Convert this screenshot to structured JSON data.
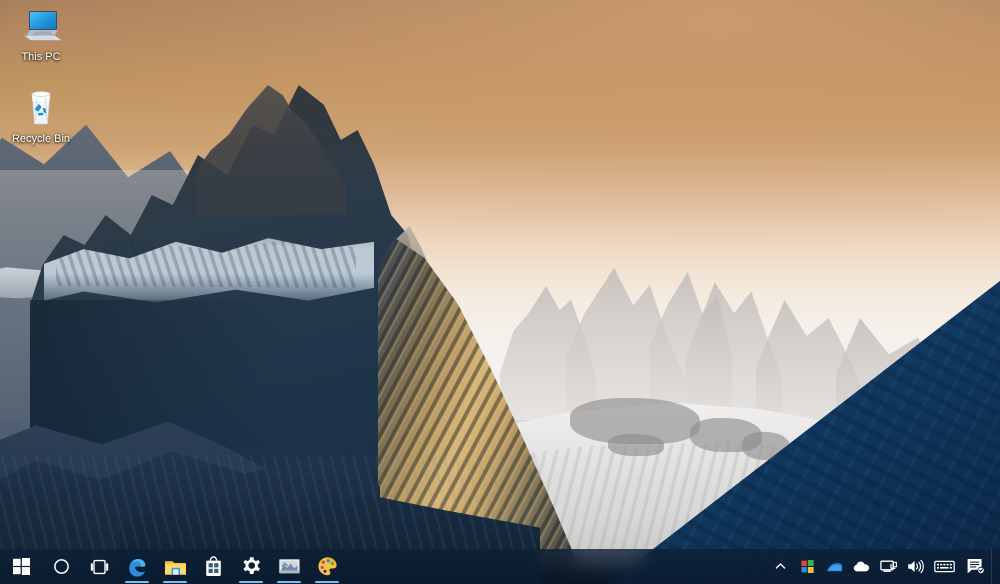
{
  "desktop": {
    "wallpaper_name": "torres-del-paine-mountains",
    "wallpaper_description": "Sunrise over jagged snow-dusted mountain peaks with warm tan sky and deep blue rock faces",
    "colors": {
      "sky_top": "#a9805d",
      "sky_mid": "#cda273",
      "sky_horizon": "#f2efec",
      "rock_dark_blue": "#1e3549",
      "rock_right_slope": "#113a62",
      "sunlit_ridge_gold": "#d9b877",
      "snow": "#e7e6e5",
      "taskbar_bg": "#0d2036",
      "taskbar_indicator": "#6fc3f0",
      "icon_label_text": "#ffffff"
    },
    "icons": [
      {
        "id": "this-pc",
        "label": "This PC",
        "icon": "monitor-computer-icon"
      },
      {
        "id": "recycle-bin",
        "label": "Recycle Bin",
        "icon": "recycle-bin-icon"
      }
    ]
  },
  "taskbar": {
    "start": {
      "label": "Start",
      "icon": "windows-logo-icon"
    },
    "search": {
      "label": "Cortana",
      "icon": "cortana-circle-icon"
    },
    "task_view": {
      "label": "Task View",
      "icon": "task-view-icon"
    },
    "pinned": [
      {
        "id": "edge",
        "label": "Microsoft Edge",
        "icon": "edge-icon",
        "running": true
      },
      {
        "id": "file-explorer",
        "label": "File Explorer",
        "icon": "folder-icon",
        "running": true
      },
      {
        "id": "store",
        "label": "Microsoft Store",
        "icon": "store-bag-icon",
        "running": false
      },
      {
        "id": "settings",
        "label": "Settings",
        "icon": "gear-icon",
        "running": true
      },
      {
        "id": "photos",
        "label": "Photos",
        "icon": "photo-picture-icon",
        "running": true
      },
      {
        "id": "paint",
        "label": "Paint",
        "icon": "paint-palette-icon",
        "running": true
      }
    ],
    "tray": [
      {
        "id": "show-hidden",
        "label": "Show hidden icons",
        "icon": "chevron-up-icon"
      },
      {
        "id": "security",
        "label": "Windows Security",
        "icon": "security-shield-icon"
      },
      {
        "id": "graphics",
        "label": "Graphics settings",
        "icon": "graphics-icon"
      },
      {
        "id": "onedrive",
        "label": "OneDrive",
        "icon": "cloud-icon"
      },
      {
        "id": "network",
        "label": "Network",
        "icon": "network-monitor-icon"
      },
      {
        "id": "volume",
        "label": "Speakers",
        "icon": "speaker-volume-icon"
      },
      {
        "id": "input",
        "label": "Input indicator",
        "icon": "keyboard-icon"
      },
      {
        "id": "action-center",
        "label": "Action Center",
        "icon": "notification-center-icon"
      }
    ],
    "show_desktop": {
      "label": "Show desktop",
      "icon": "show-desktop-sliver"
    }
  }
}
